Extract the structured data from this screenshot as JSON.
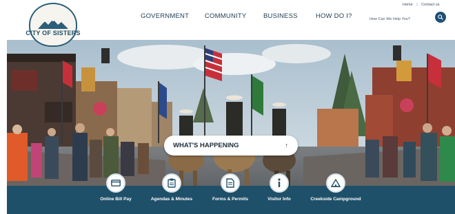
{
  "brand": {
    "name": "CITY OF SISTERS",
    "colors": {
      "primary": "#1f5069",
      "nav_text": "#1e3c52",
      "search_button": "#1f4f75"
    }
  },
  "nav": {
    "items": [
      {
        "label": "GOVERNMENT"
      },
      {
        "label": "COMMUNITY"
      },
      {
        "label": "BUSINESS"
      },
      {
        "label": "HOW DO I?"
      }
    ]
  },
  "utility": {
    "home": "Home",
    "contact": "Contact us"
  },
  "search": {
    "placeholder": "How Can We Help You?",
    "icon": "search-icon"
  },
  "hero": {
    "happening_label": "WHAT'S HAPPENING",
    "happening_icon": "arrow-up-icon"
  },
  "quick_links": [
    {
      "label": "Online Bill Pay",
      "icon": "credit-card-icon"
    },
    {
      "label": "Agendas & Minutes",
      "icon": "clipboard-icon"
    },
    {
      "label": "Forms & Permits",
      "icon": "document-icon"
    },
    {
      "label": "Visitor Info",
      "icon": "info-icon"
    },
    {
      "label": "Creekside Campground",
      "icon": "tent-icon"
    }
  ]
}
